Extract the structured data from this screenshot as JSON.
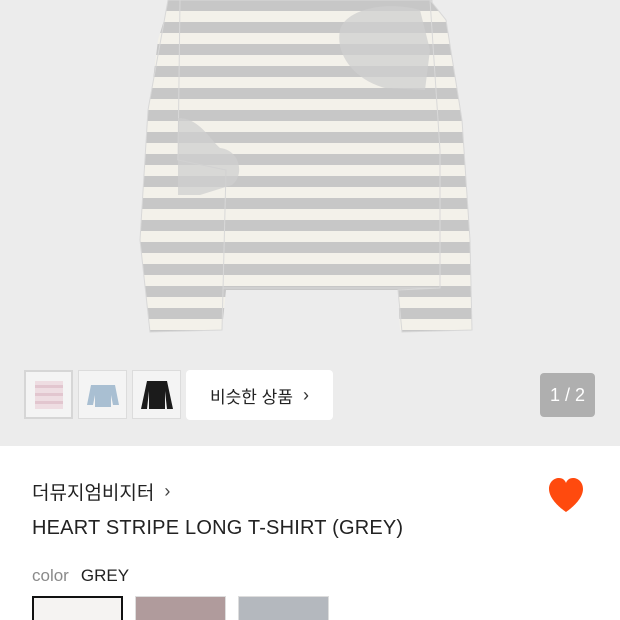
{
  "gallery": {
    "similar_label": "비슷한 상품",
    "similar_chevron": "›",
    "page_indicator": "1 / 2",
    "thumbnails": [
      {
        "name": "pink-stripe-thumbnail"
      },
      {
        "name": "blue-top-thumbnail"
      },
      {
        "name": "black-top-thumbnail"
      }
    ]
  },
  "product": {
    "brand": "더뮤지엄비지터",
    "brand_chevron": "›",
    "title": "HEART STRIPE LONG T-SHIRT (GREY)",
    "wishlist_icon": "heart-icon",
    "wishlist_color": "#ff4a0e",
    "color_label": "color",
    "color_value": "GREY",
    "swatches": [
      {
        "name": "grey",
        "color": "#f5f3f2",
        "selected": true
      },
      {
        "name": "pink",
        "color": "#b09b9c",
        "selected": false
      },
      {
        "name": "blue",
        "color": "#b4b8be",
        "selected": false
      }
    ]
  }
}
